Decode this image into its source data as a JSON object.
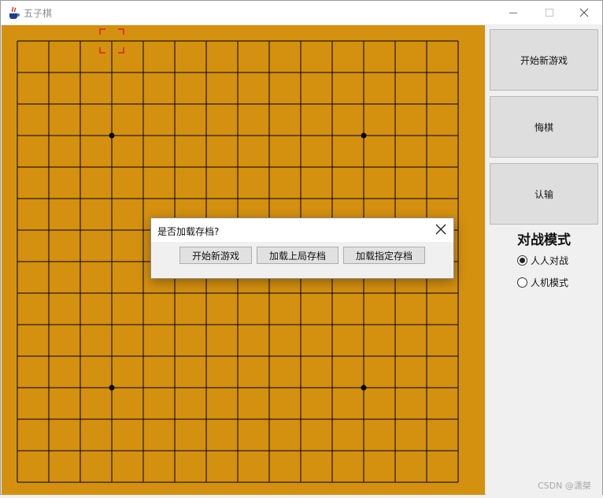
{
  "window": {
    "title": "五子棋",
    "icons": {
      "app": "java-cup-icon",
      "minimize": "minimize-icon",
      "maximize": "maximize-icon",
      "close": "close-icon"
    }
  },
  "board": {
    "size": 15,
    "background_color": "#d4900f",
    "line_color": "#000000",
    "star_points": [
      [
        3,
        3
      ],
      [
        11,
        3
      ],
      [
        3,
        11
      ],
      [
        11,
        11
      ]
    ],
    "cursor": {
      "col": 3,
      "row": 0,
      "color": "#e02020"
    }
  },
  "side_panel": {
    "buttons": [
      {
        "label": "开始新游戏"
      },
      {
        "label": "悔棋"
      },
      {
        "label": "认输"
      }
    ],
    "mode_title": "对战模式",
    "modes": [
      {
        "label": "人人对战",
        "checked": true
      },
      {
        "label": "人机模式",
        "checked": false
      }
    ],
    "watermark": "CSDN @潇桀"
  },
  "dialog": {
    "title": "是否加载存档?",
    "buttons": [
      {
        "label": "开始新游戏"
      },
      {
        "label": "加载上局存档"
      },
      {
        "label": "加载指定存档"
      }
    ]
  }
}
